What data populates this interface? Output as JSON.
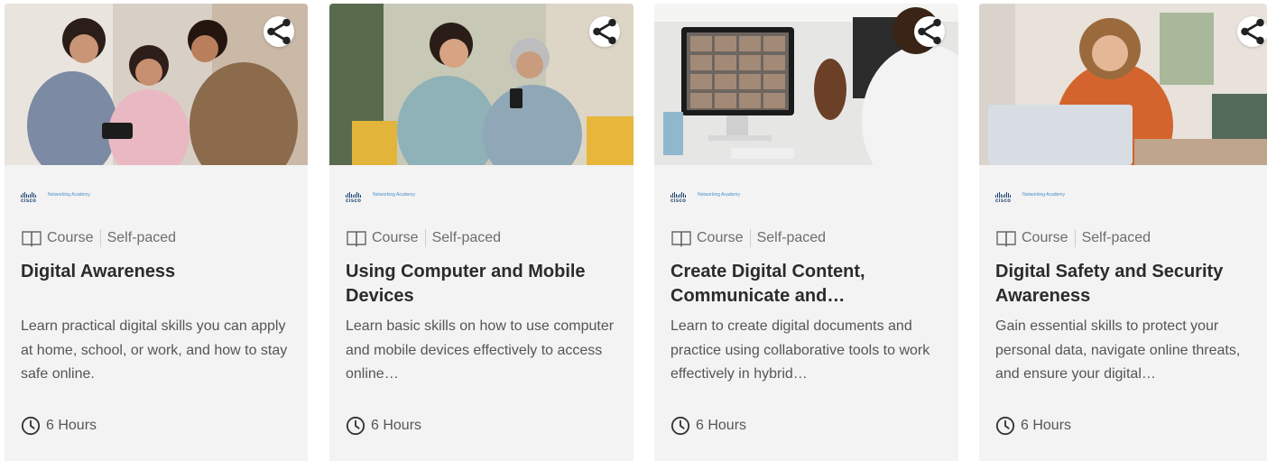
{
  "cards": [
    {
      "image_alt": "Family looking at a phone together",
      "partner_logo": {
        "brand": "cisco",
        "label": "Networking Academy"
      },
      "type_label": "Course",
      "pace_label": "Self-paced",
      "title": "Digital Awareness",
      "description": "Learn practical digital skills you can apply at home, school, or work, and how to stay safe online.",
      "duration": "6 Hours"
    },
    {
      "image_alt": "Two women using a smartphone on a couch",
      "partner_logo": {
        "brand": "cisco",
        "label": "Networking Academy"
      },
      "type_label": "Course",
      "pace_label": "Self-paced",
      "title": "Using Computer and Mobile Devices",
      "description": "Learn basic skills on how to use computer and mobile devices effectively to access online…",
      "duration": "6 Hours"
    },
    {
      "image_alt": "Person waving at a video conference call on a monitor",
      "partner_logo": {
        "brand": "cisco",
        "label": "Networking Academy"
      },
      "type_label": "Course",
      "pace_label": "Self-paced",
      "title": "Create Digital Content, Communicate and…",
      "description": "Learn to create digital documents and practice using collaborative tools to work effectively in hybrid…",
      "duration": "6 Hours"
    },
    {
      "image_alt": "Woman with a microphone in front of a laptop",
      "partner_logo": {
        "brand": "cisco",
        "label": "Networking Academy"
      },
      "type_label": "Course",
      "pace_label": "Self-paced",
      "title": "Digital Safety and Security Awareness",
      "description": "Gain essential skills to protect your personal data, navigate online threats, and ensure your digital…",
      "duration": "6 Hours"
    }
  ],
  "icons": {
    "share": "share-icon",
    "book": "book-icon",
    "clock": "clock-icon"
  },
  "colors": {
    "card_bg": "#f3f3f3",
    "title": "#2b2b2b",
    "text": "#555555",
    "muted": "#6d6d6d",
    "cisco_blue": "#1e4471"
  }
}
